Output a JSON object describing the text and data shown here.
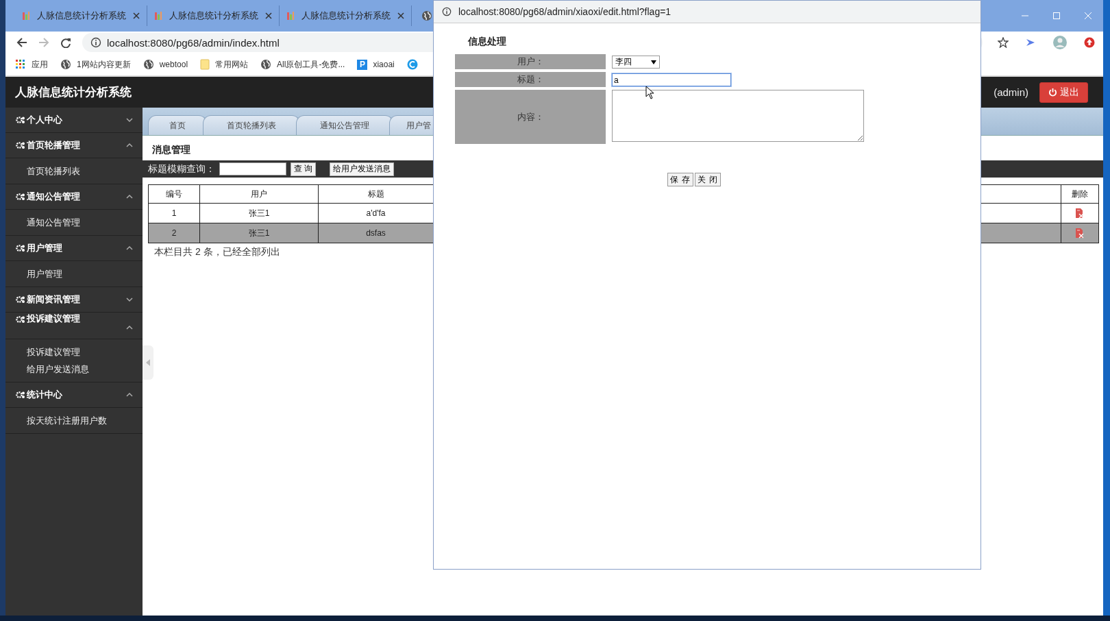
{
  "browser": {
    "tabs": [
      {
        "title": "人脉信息统计分析系统"
      },
      {
        "title": "人脉信息统计分析系统"
      },
      {
        "title": "人脉信息统计分析系统"
      }
    ],
    "address": "localhost:8080/pg68/admin/index.html",
    "bookmarks": [
      {
        "kind": "apps",
        "label": "应用"
      },
      {
        "kind": "globe",
        "label": "1网站内容更新"
      },
      {
        "kind": "globe",
        "label": "webtool"
      },
      {
        "kind": "folder",
        "label": "常用网站"
      },
      {
        "kind": "globe",
        "label": "All原创工具-免费..."
      },
      {
        "kind": "letter",
        "icon": "P",
        "label": "xiaoai"
      },
      {
        "kind": "circle"
      }
    ]
  },
  "app": {
    "title": "人脉信息统计分析系统",
    "user": "(admin)",
    "logout": "退出"
  },
  "sidebar": {
    "groups": [
      {
        "label": "个人中心",
        "expanded": false
      },
      {
        "label": "首页轮播管理",
        "expanded": true,
        "children": [
          {
            "label": "首页轮播列表"
          }
        ]
      },
      {
        "label": "通知公告管理",
        "expanded": true,
        "children": [
          {
            "label": "通知公告管理"
          }
        ]
      },
      {
        "label": "用户管理",
        "expanded": true,
        "children": [
          {
            "label": "用户管理"
          }
        ]
      },
      {
        "label": "新闻资讯管理",
        "expanded": false
      },
      {
        "label": "投诉建议管理",
        "expanded": true,
        "children": [
          {
            "label": "投诉建议管理"
          },
          {
            "label": "给用户发送消息"
          }
        ]
      },
      {
        "label": "统计中心",
        "expanded": true,
        "children": [
          {
            "label": "按天统计注册用户数"
          }
        ]
      }
    ]
  },
  "content_tabs": [
    {
      "label": "首页"
    },
    {
      "label": "首页轮播列表"
    },
    {
      "label": "通知公告管理"
    },
    {
      "label": "用户管"
    }
  ],
  "page": {
    "title": "消息管理",
    "search_label": "标题模糊查询：",
    "search_button": "查 询",
    "send_button": "给用户发送消息"
  },
  "table": {
    "columns": [
      "编号",
      "用户",
      "标题",
      "删除"
    ],
    "rows": [
      {
        "cells": [
          "1",
          "张三1",
          "a'd'fa"
        ],
        "highlighted": false
      },
      {
        "cells": [
          "2",
          "张三1",
          "dsfas"
        ],
        "highlighted": true
      }
    ]
  },
  "footer": "本栏目共 2 条，已经全部列出",
  "dialog": {
    "url": "localhost:8080/pg68/admin/xiaoxi/edit.html?flag=1",
    "title": "信息处理",
    "fields": [
      {
        "kind": "select",
        "label": "用户：",
        "value": "李四"
      },
      {
        "kind": "text",
        "label": "标题：",
        "value": "a",
        "focused": true
      },
      {
        "kind": "textarea",
        "label": "内容："
      }
    ],
    "buttons": [
      "保 存",
      "关 闭"
    ]
  }
}
